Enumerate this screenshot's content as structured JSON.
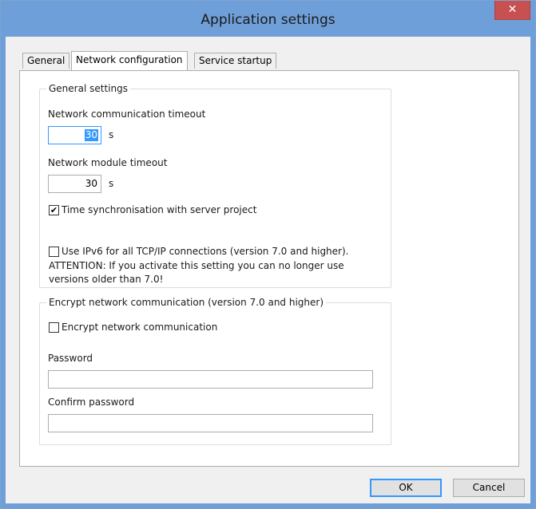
{
  "window": {
    "title": "Application settings",
    "close_glyph": "✕"
  },
  "tabs": [
    {
      "label": "General",
      "active": false
    },
    {
      "label": "Network configuration",
      "active": true
    },
    {
      "label": "Service startup",
      "active": false
    }
  ],
  "general_settings": {
    "group_label": "General settings",
    "comm_timeout": {
      "label": "Network communication timeout",
      "value": "30",
      "unit": "s"
    },
    "module_timeout": {
      "label": "Network module timeout",
      "value": "30",
      "unit": "s"
    },
    "time_sync": {
      "label": "Time synchronisation with server project",
      "checked": true,
      "check_glyph": "✔"
    },
    "ipv6": {
      "label": "Use IPv6 for all TCP/IP connections (version 7.0 and higher).",
      "checked": false,
      "warning_line1": "ATTENTION: If you activate this setting you can no longer use",
      "warning_line2": "versions older than 7.0!"
    }
  },
  "encryption": {
    "group_label": "Encrypt network communication (version 7.0 and higher)",
    "encrypt": {
      "label": "Encrypt network communication",
      "checked": false
    },
    "password": {
      "label": "Password",
      "value": ""
    },
    "confirm_password": {
      "label": "Confirm password",
      "value": ""
    }
  },
  "buttons": {
    "ok": "OK",
    "cancel": "Cancel"
  },
  "colors": {
    "title_bar": "#6f9fd8",
    "close_button": "#c75050",
    "selection": "#3399ff"
  }
}
